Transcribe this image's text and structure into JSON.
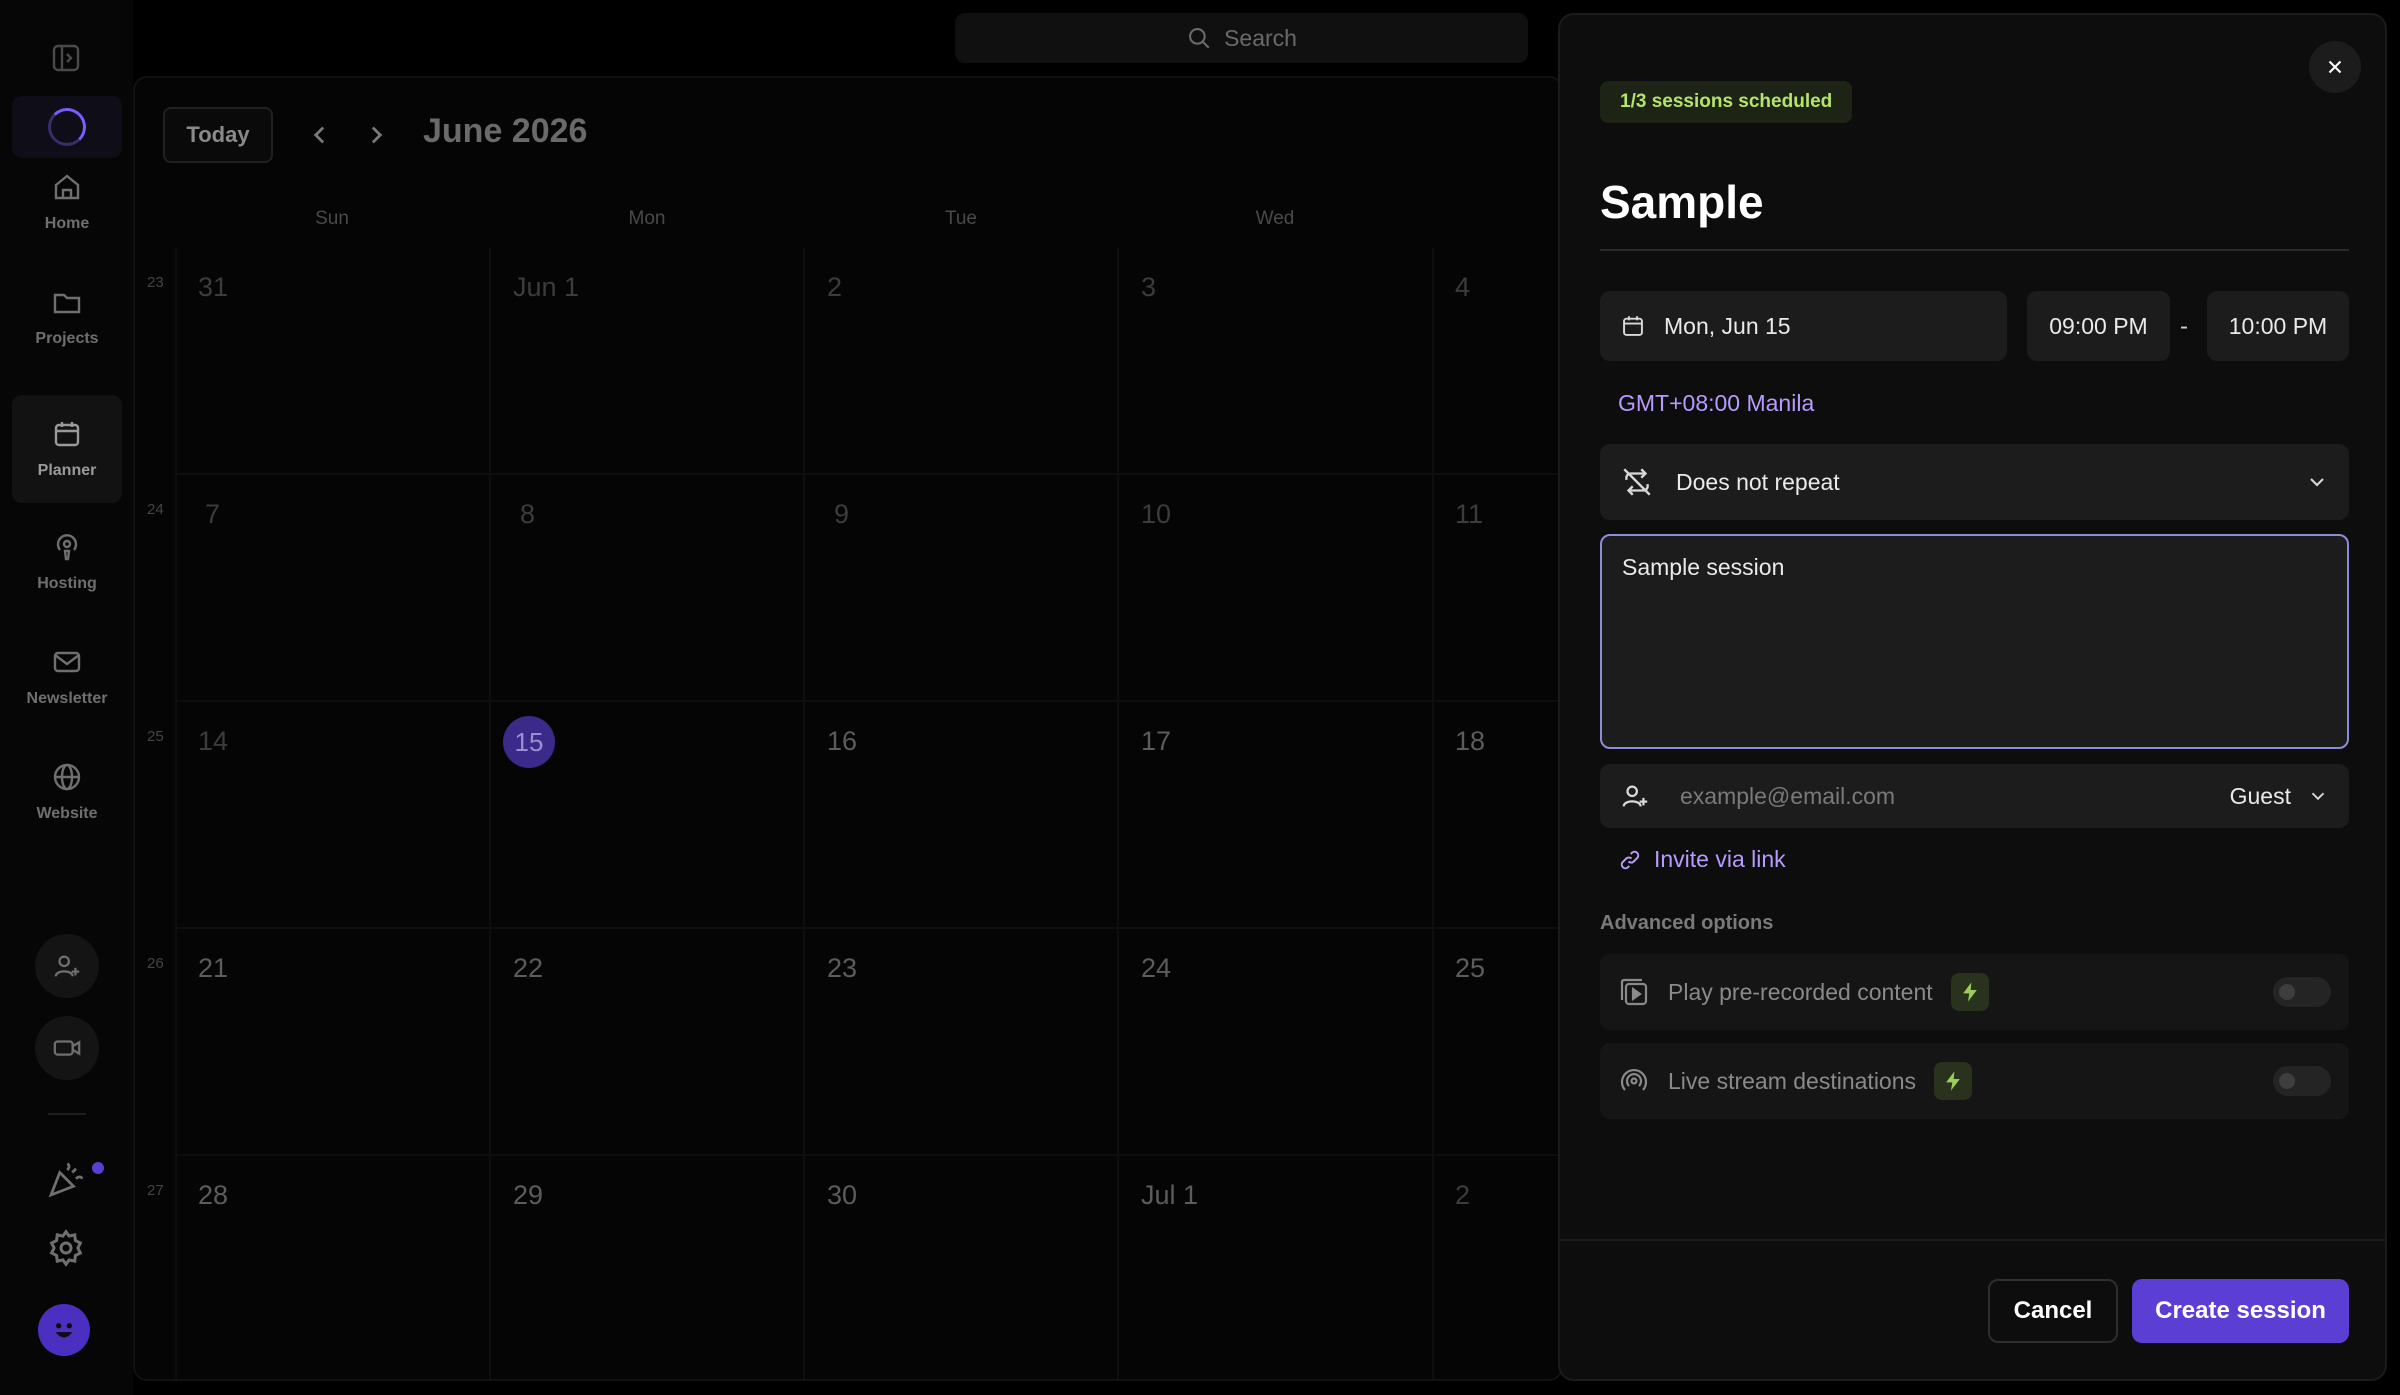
{
  "search": {
    "placeholder": "Search"
  },
  "sidebar": {
    "items": [
      {
        "label": "Home",
        "icon": "home-icon"
      },
      {
        "label": "Projects",
        "icon": "folder-icon"
      },
      {
        "label": "Planner",
        "icon": "calendar-icon"
      },
      {
        "label": "Hosting",
        "icon": "podcast-icon"
      },
      {
        "label": "Newsletter",
        "icon": "mail-icon"
      },
      {
        "label": "Website",
        "icon": "globe-icon"
      }
    ],
    "active": "Planner"
  },
  "calendar": {
    "today_label": "Today",
    "month": "June 2026",
    "weekdays": [
      "Sun",
      "Mon",
      "Tue",
      "Wed"
    ],
    "weeks": [
      {
        "num": "23",
        "days": [
          "31",
          "Jun 1",
          "2",
          "3",
          "4"
        ]
      },
      {
        "num": "24",
        "days": [
          "7",
          "8",
          "9",
          "10",
          "11"
        ]
      },
      {
        "num": "25",
        "days": [
          "14",
          "15",
          "16",
          "17",
          "18"
        ]
      },
      {
        "num": "26",
        "days": [
          "21",
          "22",
          "23",
          "24",
          "25"
        ]
      },
      {
        "num": "27",
        "days": [
          "28",
          "29",
          "30",
          "Jul 1",
          "2"
        ]
      }
    ],
    "highlighted_day": "15"
  },
  "panel": {
    "badge": "1/3 sessions scheduled",
    "title": "Sample",
    "date": "Mon, Jun 15",
    "start_time": "09:00 PM",
    "time_separator": "-",
    "end_time": "10:00 PM",
    "timezone": "GMT+08:00 Manila",
    "repeat": "Does not repeat",
    "description": "Sample session",
    "email_placeholder": "example@email.com",
    "role": "Guest",
    "invite_link": "Invite via link",
    "advanced_label": "Advanced options",
    "options": [
      {
        "label": "Play pre-recorded content",
        "enabled": false
      },
      {
        "label": "Live stream destinations",
        "enabled": false
      }
    ],
    "cancel": "Cancel",
    "create": "Create session"
  },
  "colors": {
    "accent": "#5b3fd4",
    "link": "#b79bff",
    "badge_text": "#b6e36a"
  }
}
